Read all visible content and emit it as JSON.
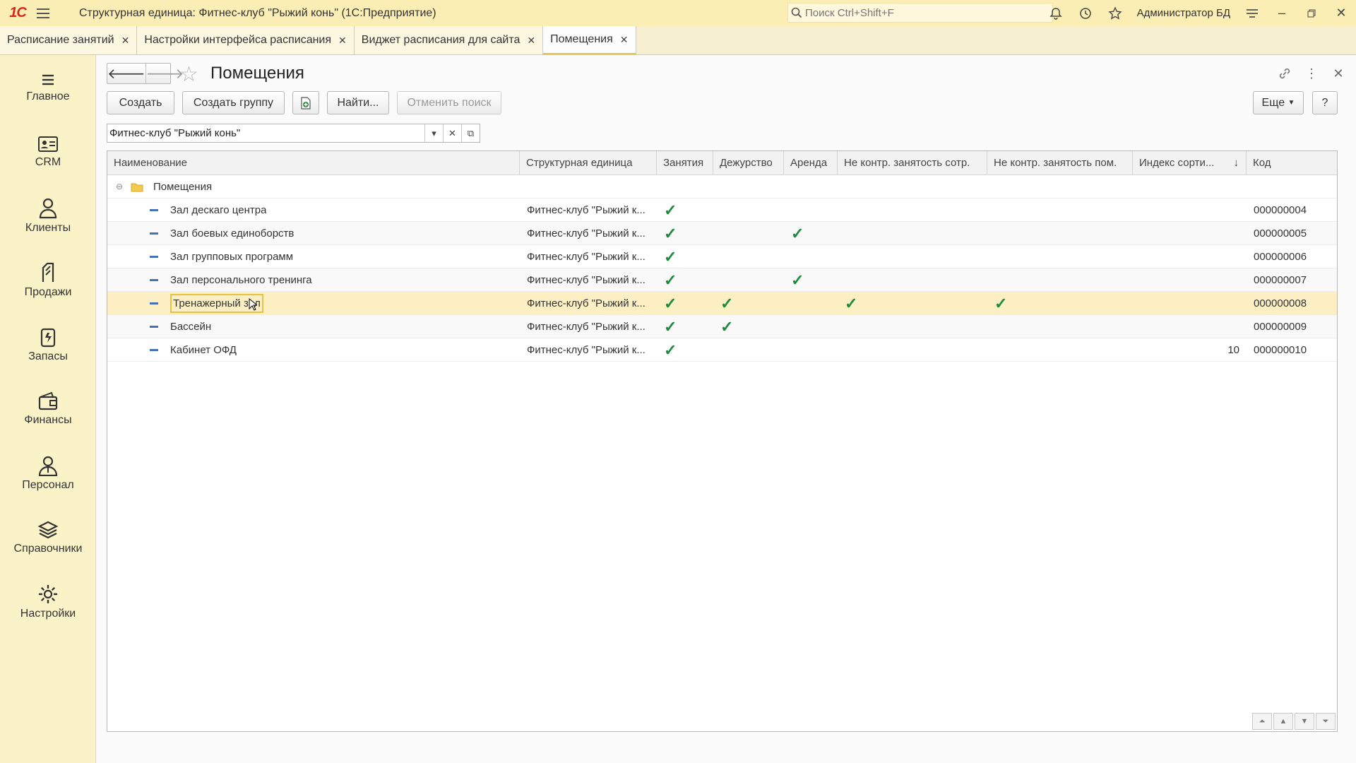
{
  "window": {
    "logo": "1С",
    "title": "Структурная единица: Фитнес-клуб \"Рыжий конь\"  (1С:Предприятие)",
    "search_placeholder": "Поиск Ctrl+Shift+F",
    "user": "Администратор БД"
  },
  "tabs": [
    {
      "label": "Расписание занятий"
    },
    {
      "label": "Настройки интерфейса расписания"
    },
    {
      "label": "Виджет расписания для сайта"
    },
    {
      "label": "Помещения"
    }
  ],
  "sidebar": [
    {
      "label": "Главное",
      "icon": "menu-icon"
    },
    {
      "label": "CRM",
      "icon": "crm-card-icon"
    },
    {
      "label": "Клиенты",
      "icon": "clients-icon"
    },
    {
      "label": "Продажи",
      "icon": "sales-icon"
    },
    {
      "label": "Запасы",
      "icon": "stock-icon"
    },
    {
      "label": "Финансы",
      "icon": "wallet-icon"
    },
    {
      "label": "Персонал",
      "icon": "staff-icon"
    },
    {
      "label": "Справочники",
      "icon": "books-icon"
    },
    {
      "label": "Настройки",
      "icon": "gear-icon"
    }
  ],
  "form": {
    "title": "Помещения",
    "buttons": {
      "create": "Создать",
      "create_group": "Создать группу",
      "find": "Найти...",
      "cancel_search": "Отменить поиск",
      "more": "Еще",
      "help": "?"
    },
    "filter_value": "Фитнес-клуб \"Рыжий конь\""
  },
  "table": {
    "columns": [
      "Наименование",
      "Структурная единица",
      "Занятия",
      "Дежурство",
      "Аренда",
      "Не контр. занятость сотр.",
      "Не контр. занятость пом.",
      "Индекс сорти...",
      "Код"
    ],
    "sort_indicator": "↓",
    "group_name": "Помещения",
    "check_mark": "✓",
    "rows": [
      {
        "name": "Зал дескаго центра",
        "unit": "Фитнес-клуб \"Рыжий к...",
        "classes": true,
        "duty": false,
        "rent": false,
        "nc_staff": false,
        "nc_room": false,
        "sort_index": "",
        "code": "000000004"
      },
      {
        "name": "Зал боевых единоборств",
        "unit": "Фитнес-клуб \"Рыжий к...",
        "classes": true,
        "duty": false,
        "rent": true,
        "nc_staff": false,
        "nc_room": false,
        "sort_index": "",
        "code": "000000005"
      },
      {
        "name": "Зал групповых программ",
        "unit": "Фитнес-клуб \"Рыжий к...",
        "classes": true,
        "duty": false,
        "rent": false,
        "nc_staff": false,
        "nc_room": false,
        "sort_index": "",
        "code": "000000006"
      },
      {
        "name": "Зал персонального тренинга",
        "unit": "Фитнес-клуб \"Рыжий к...",
        "classes": true,
        "duty": false,
        "rent": true,
        "nc_staff": false,
        "nc_room": false,
        "sort_index": "",
        "code": "000000007"
      },
      {
        "name": "Тренажерный зал",
        "unit": "Фитнес-клуб \"Рыжий к...",
        "classes": true,
        "duty": true,
        "rent": false,
        "nc_staff": true,
        "nc_room": true,
        "sort_index": "",
        "code": "000000008",
        "selected": true
      },
      {
        "name": "Бассейн",
        "unit": "Фитнес-клуб \"Рыжий к...",
        "classes": true,
        "duty": true,
        "rent": false,
        "nc_staff": false,
        "nc_room": false,
        "sort_index": "",
        "code": "000000009"
      },
      {
        "name": "Кабинет ОФД",
        "unit": "Фитнес-клуб \"Рыжий к...",
        "classes": true,
        "duty": false,
        "rent": false,
        "nc_staff": false,
        "nc_room": false,
        "sort_index": "10",
        "code": "000000010"
      }
    ]
  }
}
